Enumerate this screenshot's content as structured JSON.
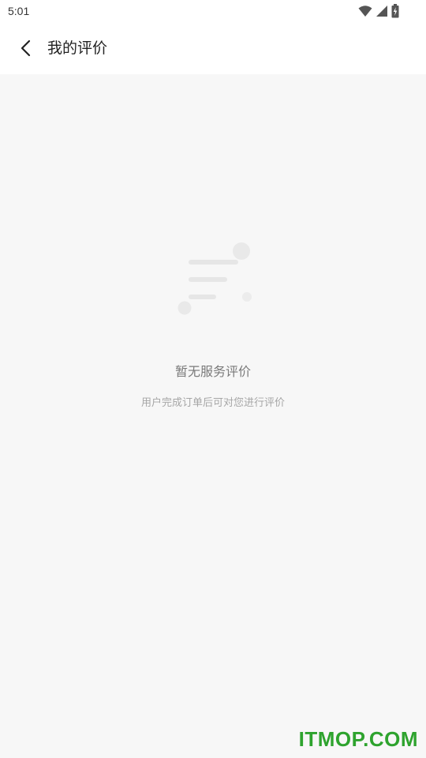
{
  "status_bar": {
    "time": "5:01",
    "icons": [
      "wifi-icon",
      "signal-icon",
      "battery-charging-icon"
    ]
  },
  "app_bar": {
    "back_icon": "chevron-left-icon",
    "title": "我的评价"
  },
  "empty_state": {
    "icon": "empty-list-illustration",
    "title": "暂无服务评价",
    "subtitle": "用户完成订单后可对您进行评价"
  },
  "watermark": {
    "text": "ITMOP.COM",
    "color": "#2ea32e"
  }
}
